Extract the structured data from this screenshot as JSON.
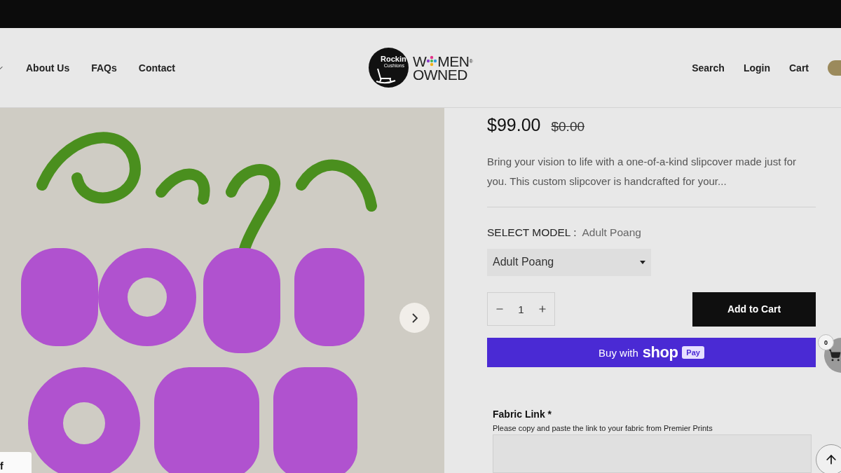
{
  "header": {
    "nav_left": [
      {
        "label": "About Us"
      },
      {
        "label": "FAQs"
      },
      {
        "label": "Contact"
      }
    ],
    "logo": {
      "brand": "Rockin",
      "brand_sub": "Cushions",
      "badge_start": "W",
      "badge_end": "MEN",
      "badge_mark": "®",
      "badge_line2": "OWNED"
    },
    "nav_right": [
      {
        "label": "Search"
      },
      {
        "label": "Login"
      },
      {
        "label": "Cart"
      }
    ]
  },
  "gallery": {
    "side_tab": "f"
  },
  "product": {
    "price": "$99.00",
    "compare_price": "$0.00",
    "description": "Bring your vision to life with a one-of-a-kind slipcover made just for you. This custom slipcover is handcrafted for your...",
    "option_label": "SELECT MODEL :",
    "option_value": "Adult Poang",
    "select_value": "Adult Poang",
    "quantity": "1",
    "add_button": "Add to Cart",
    "shop_pay": {
      "prefix": "Buy with",
      "brand": "shop",
      "badge": "Pay"
    },
    "fabric_field": {
      "label": "Fabric Link *",
      "help": "Please copy and paste the link to your fabric from Premier Prints"
    }
  },
  "floating_cart": {
    "count": "0"
  }
}
